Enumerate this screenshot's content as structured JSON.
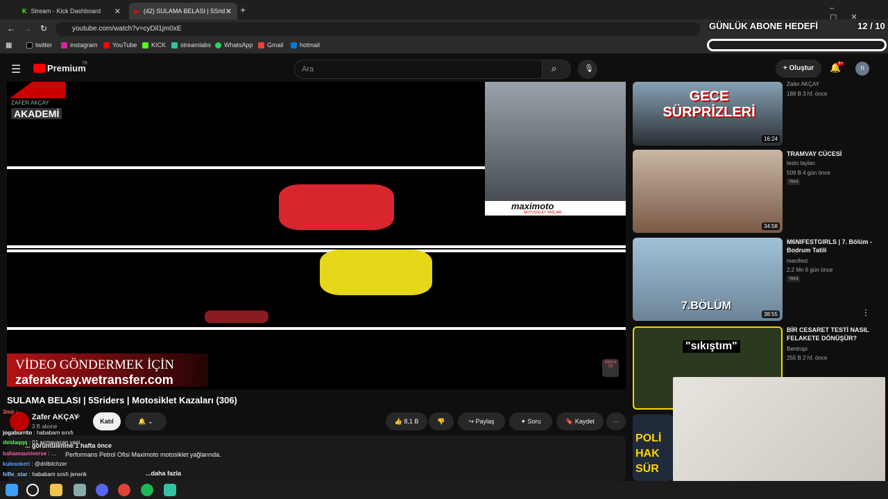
{
  "browser": {
    "tabs": [
      {
        "label": "Stream - Kick Dashboard"
      },
      {
        "label": "(42) SULAMA BELASI | 5Srid"
      }
    ],
    "url": "youtube.com/watch?v=cyDil1jm0xE",
    "bookmarks": [
      "twitter",
      "instagram",
      "YouTube",
      "KICK",
      "streamlabs",
      "WhatsApp",
      "Gmail",
      "hotmail"
    ]
  },
  "overlay": {
    "goal_title": "GÜNLÜK ABONE HEDEFİ",
    "goal_count": "12 / 10"
  },
  "youtube": {
    "logo": "Premium",
    "logo_sup": "TR",
    "search_placeholder": "Ara",
    "create_label": "Oluştur",
    "notif_badge": "9+",
    "avatar_letter": "n"
  },
  "video": {
    "brand_top": "ZAFER AKÇAY",
    "brand_akademi": "AKADEMİ",
    "banner_line1": "VİDEO GÖNDERMEK İÇİN",
    "banner_line2": "zaferakcay.wetransfer.com",
    "sponsor": "maximoto",
    "sponsor_sub": "MOTOSİKLET YAĞLARI",
    "abone": "Abone Ol",
    "title": "SULAMA BELASI | 5Sriders | Motosiklet Kazaları (306)",
    "channel": "Zafer AKÇAY",
    "subs": "3 B abone",
    "join": "Katıl",
    "likes": "8,1 B",
    "share": "Paylaş",
    "ask": "Soru",
    "save": "Kaydet",
    "desc_line1": "... görüntülenme 1 hafta önce",
    "desc_line2": "Performans Petrol Ofisi Maximoto motosiklet yağlarında.",
    "desc_more": "...daha fazla"
  },
  "sidebar": [
    {
      "title": "",
      "channel": "Zafer AKÇAY",
      "meta": "188 B  3 hf. önce",
      "duration": "16:24",
      "thumb_text": "GECE SÜRPRİZLERİ"
    },
    {
      "title": "TRAMVAY CÜCESİ",
      "channel": "testo taylan",
      "meta": "509 B  4 gün önce",
      "badge": "Yeni",
      "duration": "34:58"
    },
    {
      "title": "M6NIFESTGIRLS | 7. Bölüm - Bodrum Tatili",
      "channel": "manifest",
      "meta": "2,2 Mn  6 gün önce",
      "badge": "Yeni",
      "duration": "38:55",
      "thumb_text": "7.BÖLÜM"
    },
    {
      "title": "BİR CESARET TESTİ NASIL FELAKETE DÖNÜŞÜR?",
      "channel": "Bentropi",
      "meta": "255 B  2 hf. önce",
      "thumb_text": "\"sıkıştım\""
    },
    {
      "thumb_text": "POLİ HAK SÜR"
    }
  ],
  "chat": [
    {
      "user": "3mir",
      "text": ":"
    },
    {
      "user": "jogaburrito",
      "text": ": hababam sınıfı"
    },
    {
      "user": "deidaqqq",
      "text": ": 01 acmayacan yani"
    },
    {
      "user": "bahamauniverse",
      "text": ": ..."
    },
    {
      "user": "kuleaskeri",
      "text": ": @drilbitchzer"
    },
    {
      "user": "hifle_star",
      "text": ": hababam sınıfı jenerik"
    }
  ],
  "colors": {
    "accent": "#ff0000",
    "yt_bg": "#0f0f0f",
    "chip": "#272727"
  }
}
